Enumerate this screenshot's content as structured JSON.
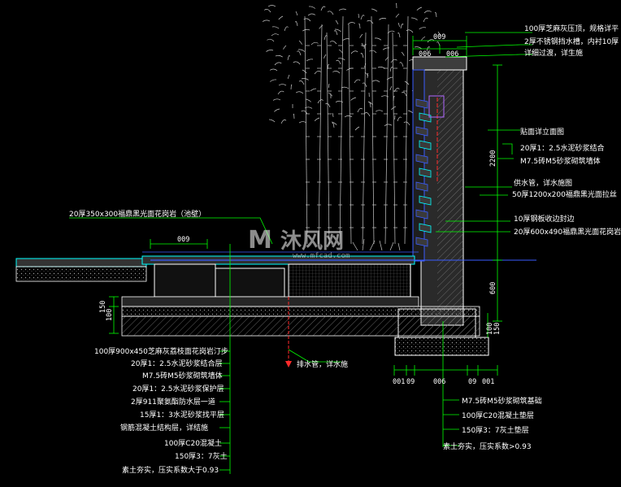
{
  "labels_top_right": [
    "100厚芝麻灰压顶，规格详平",
    "2厚不锈钢挡水槽，内衬10厚",
    "详细过渡，详生施",
    "贴面详立面图",
    "20厚1：2.5水泥砂浆结合",
    "M7.5砖M5砂浆砌筑墙体",
    "供水管，详水施图",
    "50厚1200x200福鼎黑光面拉丝",
    "10厚钢板收边封边",
    "20厚600x490福鼎黑光面花岗岩"
  ],
  "label_left_top": "20厚350x300福鼎黑光面花岗岩（池壁）",
  "label_drain": "排水管，详水施",
  "labels_bottom_left": [
    "100厚900x450芝麻灰荔枝面花岗岩汀步",
    "20厚1：2.5水泥砂浆结合层",
    "M7.5砖M5砂浆砌筑墙体",
    "20厚1：2.5水泥砂浆保护层",
    "2厚911聚氨酯防水层一道",
    "15厚1：3水泥砂浆找平层",
    "钢筋混凝土结构层，详结施",
    "100厚C20混凝土",
    "150厚3：7灰土",
    "素土夯实，压实系数大于0.93"
  ],
  "labels_bottom_right": [
    "M7.5砖M5砂浆砌筑基础",
    "100厚C20混凝土垫层",
    "150厚3：7灰土垫层",
    "素土夯实，压实系数>0.93"
  ],
  "dims": {
    "top_width": "009",
    "top_sub": [
      "006",
      "006"
    ],
    "wall_height": "2200",
    "lower_height": "600",
    "left_small": "009",
    "left_bottom": [
      "100",
      "150"
    ],
    "right_bottom": [
      "100",
      "150"
    ],
    "bottom_ticks_left": [
      "001",
      "09"
    ],
    "bottom_ticks_mid": "006",
    "bottom_ticks_right": [
      "09",
      "001"
    ]
  },
  "watermark": {
    "text": "沐风网",
    "url": "www.mfcad.com"
  },
  "colors": {
    "background": "#000000",
    "line_white": "#ffffff",
    "leader_green": "#00ff00",
    "section_cyan": "#00ffff",
    "water_blue": "#3a5cff",
    "pipe_red": "#ff2a2a",
    "plant_grey": "#c8c8c8",
    "hatch_grey": "#9a9a9a"
  }
}
